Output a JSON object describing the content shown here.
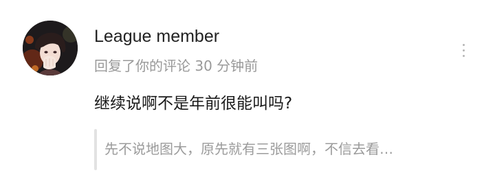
{
  "comment": {
    "username": "League member",
    "meta": "回复了你的评论 30 分钟前",
    "reply_text": "继续说啊不是年前很能叫吗?",
    "quoted_text": "先不说地图大，原先就有三张图啊，不信去看…",
    "more_icon": "more-vertical-icon",
    "avatar_icon": "user-avatar"
  },
  "colors": {
    "username": "#222222",
    "meta": "#999999",
    "reply": "#1a1a1a",
    "quote_text": "#9b9b9b",
    "quote_bar": "#e2e2e2"
  }
}
